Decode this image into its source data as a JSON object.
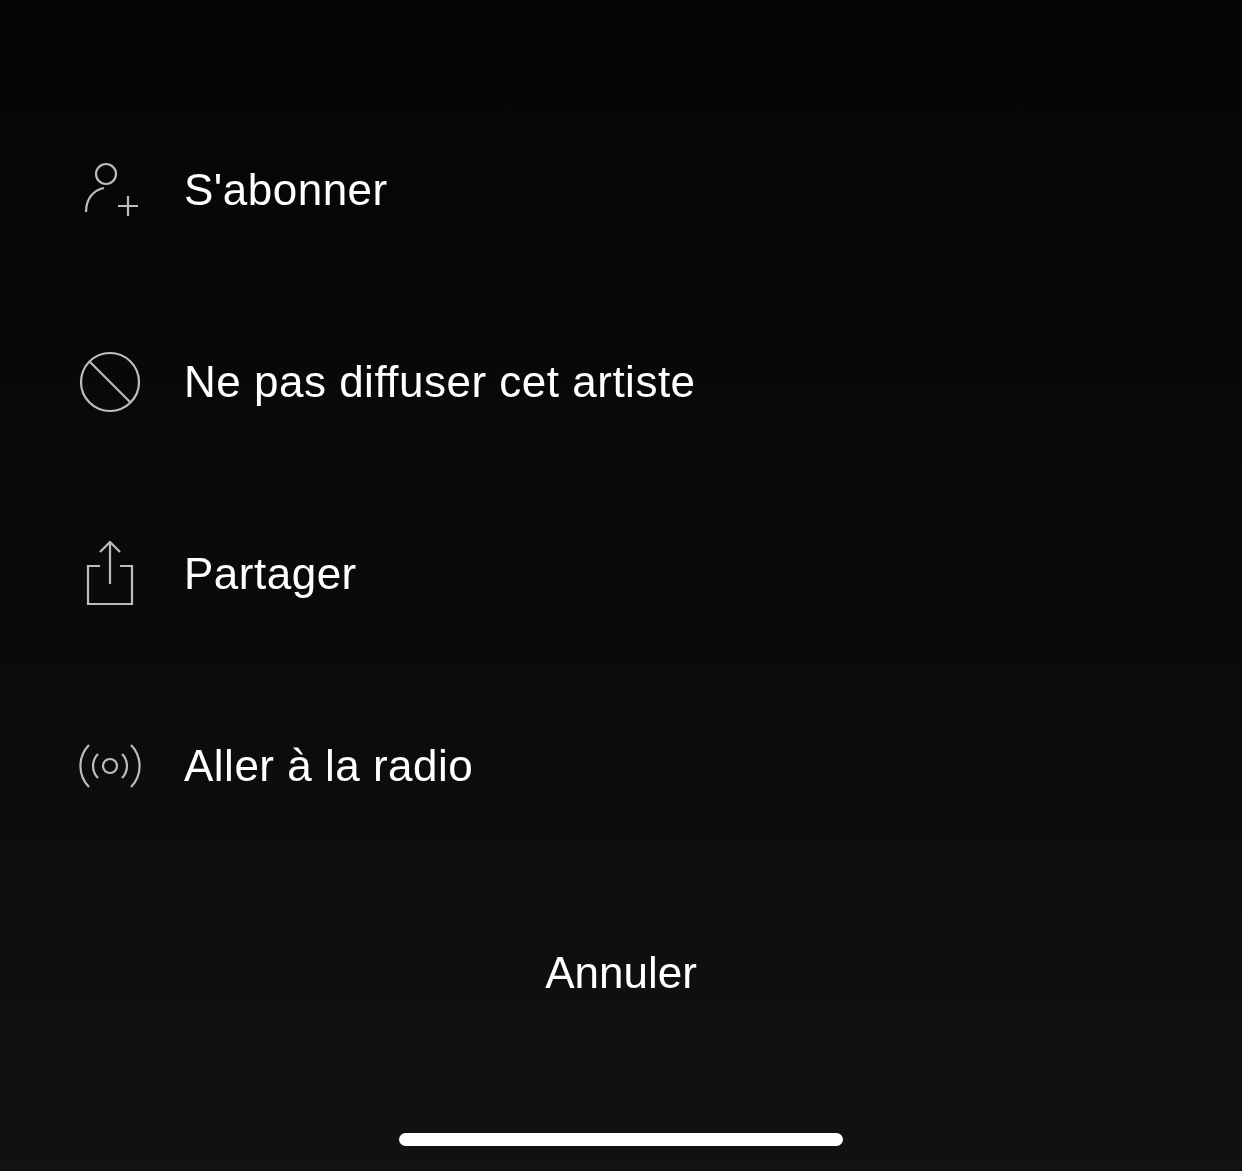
{
  "menu": {
    "items": [
      {
        "label": "S'abonner"
      },
      {
        "label": "Ne pas diffuser cet artiste"
      },
      {
        "label": "Partager"
      },
      {
        "label": "Aller à la radio"
      }
    ]
  },
  "cancel": "Annuler"
}
